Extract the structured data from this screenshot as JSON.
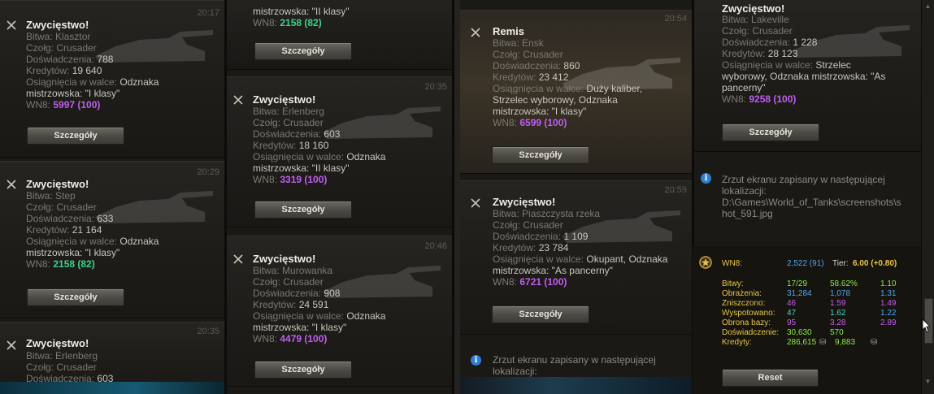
{
  "labels": {
    "battle": "Bitwa:",
    "tank": "Czołg:",
    "xp": "Doświadczenia:",
    "credits": "Kredytów:",
    "achievements": "Osiągnięcia w walce:",
    "wn8": "WN8:",
    "details_button": "Szczegóły"
  },
  "col1": [
    {
      "title": "Zwycięstwo!",
      "time": "20:17",
      "battle": "Klasztor",
      "tank": "Crusader",
      "xp": "788",
      "credits": "19 640",
      "achievements_a": "Odznaka",
      "achievements_b": "mistrzowska: \"I klasy\"",
      "wn8": "5997 (100)",
      "wn8_color": "purple"
    },
    {
      "title": "Zwycięstwo!",
      "time": "20:29",
      "battle": "Step",
      "tank": "Crusader",
      "xp": "633",
      "credits": "21 164",
      "achievements_a": "Odznaka",
      "achievements_b": "mistrzowska: \"I klasy\"",
      "wn8": "2158 (82)",
      "wn8_color": "green"
    },
    {
      "title": "Zwycięstwo!",
      "time": "20:35",
      "battle": "Erlenberg",
      "tank": "Crusader",
      "xp": "603"
    }
  ],
  "col2": [
    {
      "line_a": "mistrzowska: \"II klasy\"",
      "wn8": "2158 (82)"
    },
    {
      "title": "Zwycięstwo!",
      "time": "20:35",
      "battle": "Erlenberg",
      "tank": "Crusader",
      "xp": "603",
      "credits": "18 160",
      "achievements_a": "Odznaka",
      "achievements_b": "mistrzowska: \"II klasy\"",
      "wn8": "3319 (100)"
    },
    {
      "title": "Zwycięstwo!",
      "time": "20:46",
      "battle": "Murowanka",
      "tank": "Crusader",
      "xp": "908",
      "credits": "24 591",
      "achievements_a": "Odznaka",
      "achievements_b": "mistrzowska: \"I klasy\"",
      "wn8": "4479 (100)"
    }
  ],
  "col3": [
    {
      "title": "Remis",
      "time": "20:54",
      "battle": "Ensk",
      "tank": "Crusader",
      "xp": "860",
      "credits": "23 412",
      "achievements_a": "Duży kaliber,",
      "achievements_b": "Strzelec wyborowy, Odznaka",
      "achievements_c": "mistrzowska: \"I klasy\"",
      "wn8": "6599 (100)"
    },
    {
      "title": "Zwycięstwo!",
      "time": "20:59",
      "battle": "Piaszczysta rzeka",
      "tank": "Crusader",
      "xp": "1 109",
      "credits": "23 784",
      "achievements_a": "Okupant, Odznaka",
      "achievements_b": "mistrzowska: \"As pancerny\"",
      "wn8": "6721 (100)"
    },
    {
      "info_a": "Zrzut ekranu zapisany w następującej",
      "info_b": "lokalizacji:"
    }
  ],
  "col4": {
    "card": {
      "title": "Zwycięstwo!",
      "battle": "Lakeville",
      "tank": "Crusader",
      "xp": "1 228",
      "credits": "28 123",
      "achievements_a": "Strzelec",
      "achievements_b": "wyborowy, Odznaka mistrzowska: \"As",
      "achievements_c": "pancerny\"",
      "wn8": "9258 (100)"
    },
    "info": {
      "line1": "Zrzut ekranu zapisany w następującej",
      "line2": "lokalizacji:",
      "line3": "D:\\Games\\World_of_Tanks\\screenshots\\s",
      "line4": "hot_591.jpg"
    },
    "stats": {
      "wn8_label": "WN8:",
      "wn8_value": "2,522 (91)",
      "tier_label": "Tier:",
      "tier_value": "6.00 (+0.80)",
      "rows": [
        {
          "label": "Bitwy:",
          "a": "17/29",
          "b": "58.62%",
          "c": "1.10"
        },
        {
          "label": "Obrażenia:",
          "a": "31,284",
          "b": "1,078",
          "c": "1.31"
        },
        {
          "label": "Zniszczono:",
          "a": "46",
          "b": "1.59",
          "c": "1.49"
        },
        {
          "label": "Wyspotowano:",
          "a": "47",
          "b": "1.62",
          "c": "1.22"
        },
        {
          "label": "Obrona bazy:",
          "a": "95",
          "b": "3.28",
          "c": "2.89"
        },
        {
          "label": "Doświadczenie:",
          "a": "30,630",
          "b": "570",
          "c": ""
        },
        {
          "label": "Kredyty:",
          "a": "286,615",
          "b": "9,883",
          "c": ""
        }
      ],
      "reset_label": "Reset"
    }
  }
}
